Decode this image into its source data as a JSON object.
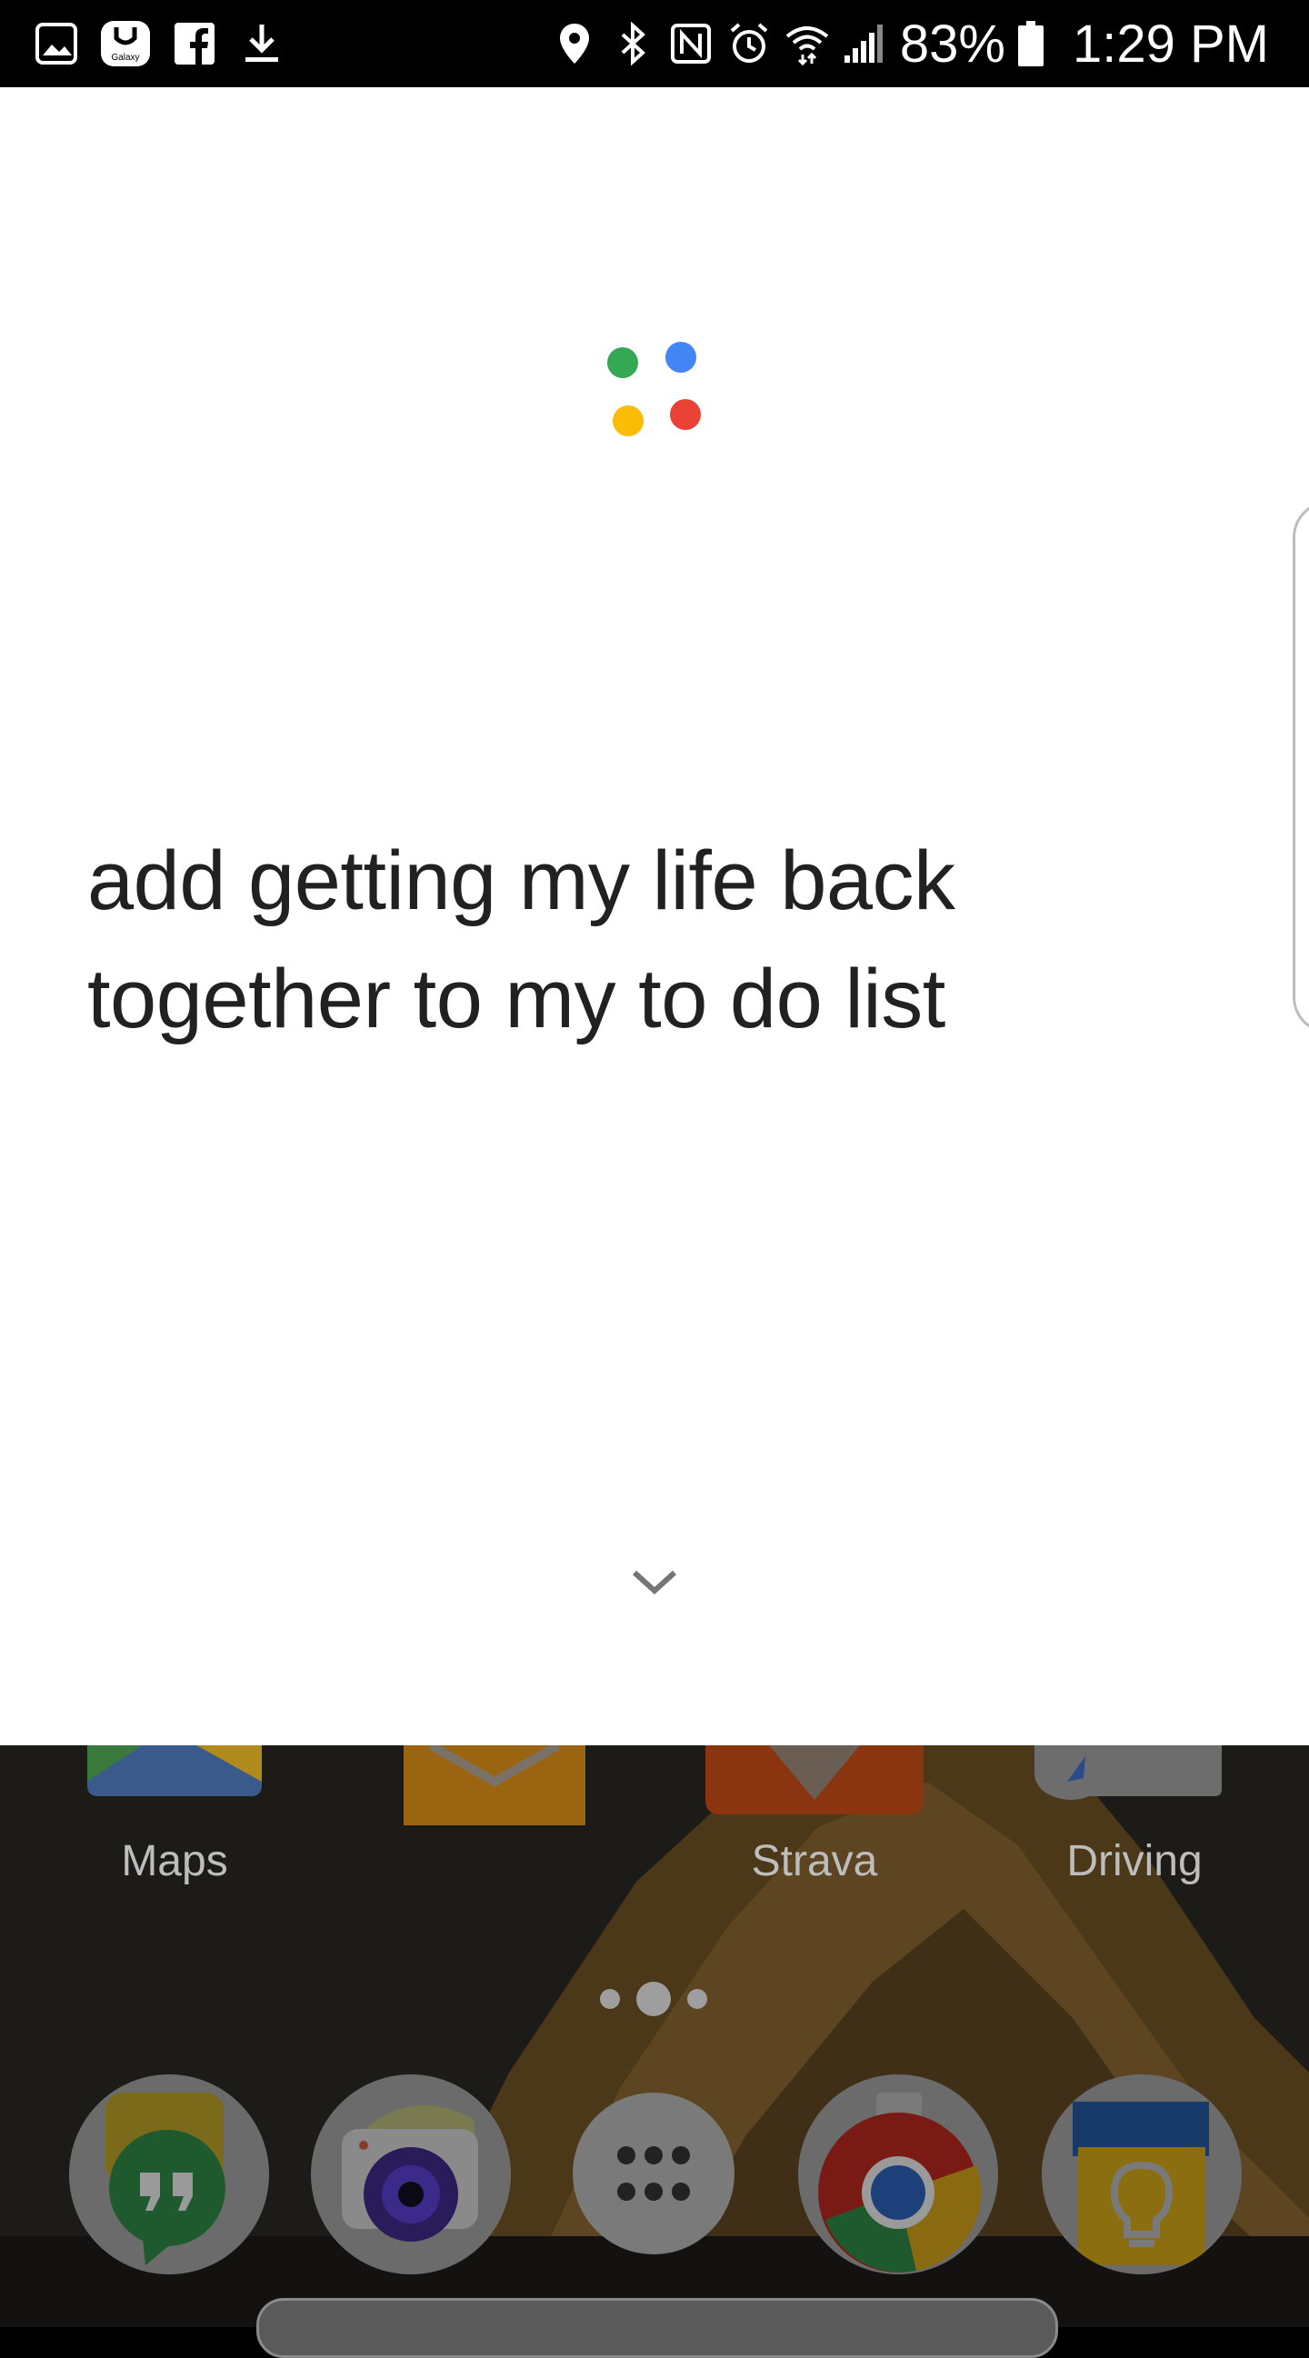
{
  "status_bar": {
    "left_icons": [
      "gallery-icon",
      "galaxy-apps-icon",
      "facebook-icon",
      "download-icon"
    ],
    "galaxy_label": "Galaxy",
    "right_icons": [
      "location-icon",
      "bluetooth-icon",
      "nfc-icon",
      "alarm-icon",
      "wifi-icon",
      "signal-icon",
      "battery-icon"
    ],
    "battery_percent": "83%",
    "time": "1:29 PM"
  },
  "assistant": {
    "logo_dots": {
      "green": "#34a853",
      "blue": "#4285f4",
      "yellow": "#fbbc05",
      "red": "#ea4335"
    },
    "query_line1": "add getting my life back",
    "query_line2": "together to my to do list",
    "collapse_icon": "chevron-down-icon"
  },
  "home_screen": {
    "app_labels": [
      "Maps",
      "Strava",
      "Driving"
    ],
    "page_indicator": {
      "pages": 3,
      "current": 2
    },
    "dock": [
      "hangouts-icon",
      "camera-icon",
      "apps-drawer-icon",
      "chrome-icon",
      "keep-icon"
    ]
  }
}
